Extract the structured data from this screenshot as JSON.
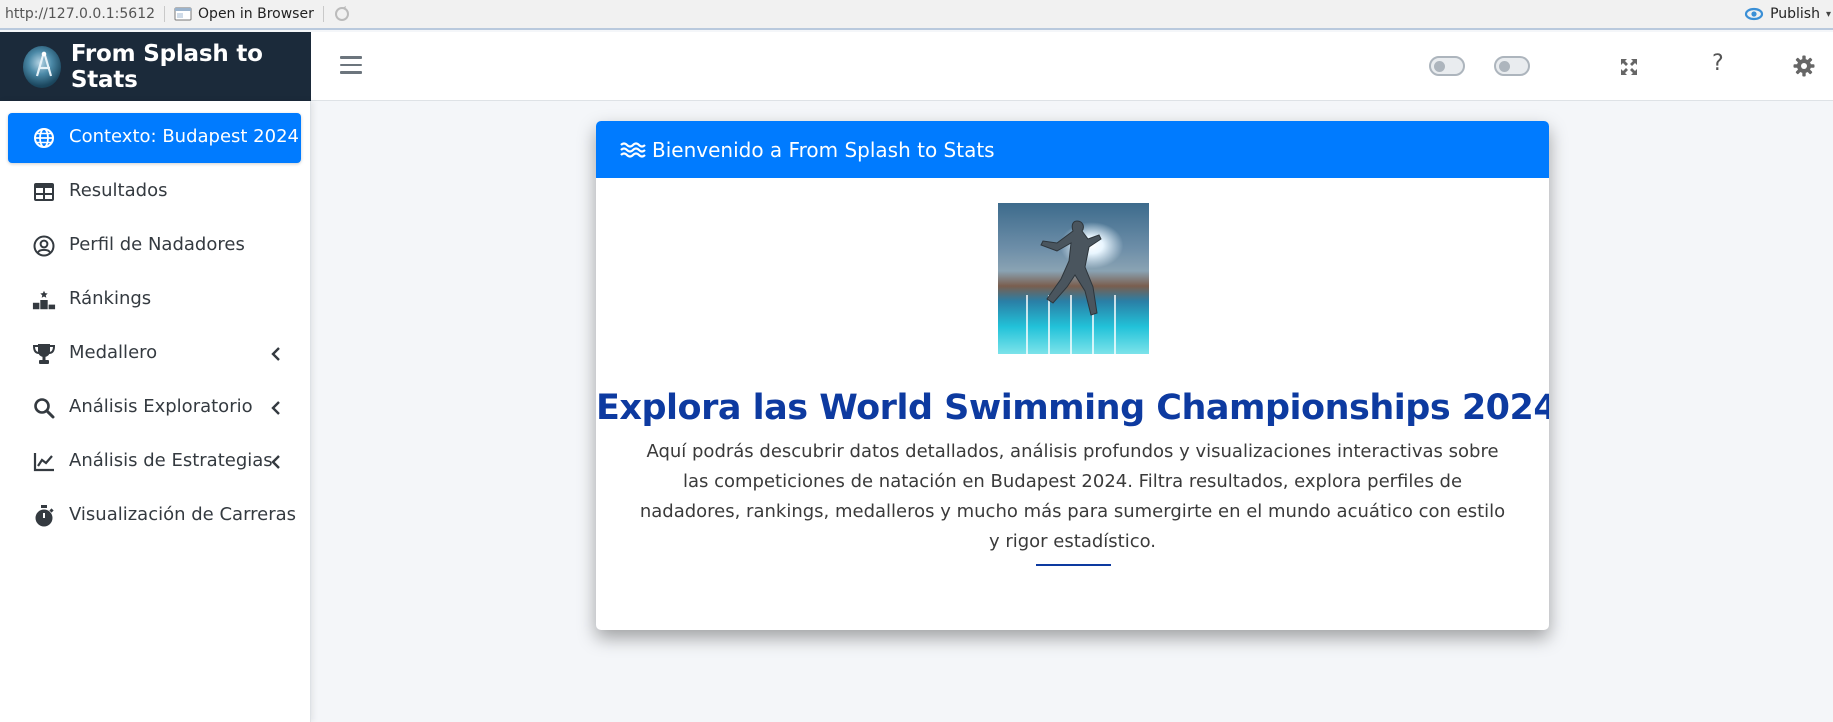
{
  "viewer": {
    "url": "http://127.0.0.1:5612",
    "open_in_browser": "Open in Browser",
    "publish": "Publish"
  },
  "brand": {
    "title": "From Splash to Stats",
    "logo_icon": "swimmer-logo"
  },
  "sidebar": {
    "items": [
      {
        "label": "Contexto: Budapest 2024",
        "icon": "globe-icon",
        "active": true,
        "has_submenu": false
      },
      {
        "label": "Resultados",
        "icon": "table-icon",
        "active": false,
        "has_submenu": false
      },
      {
        "label": "Perfil de Nadadores",
        "icon": "user-circle-icon",
        "active": false,
        "has_submenu": false
      },
      {
        "label": "Ránkings",
        "icon": "podium-icon",
        "active": false,
        "has_submenu": false
      },
      {
        "label": "Medallero",
        "icon": "trophy-icon",
        "active": false,
        "has_submenu": true
      },
      {
        "label": "Análisis Exploratorio",
        "icon": "search-icon",
        "active": false,
        "has_submenu": true
      },
      {
        "label": "Análisis de Estrategias",
        "icon": "line-chart-icon",
        "active": false,
        "has_submenu": true
      },
      {
        "label": "Visualización de Carreras",
        "icon": "stopwatch-icon",
        "active": false,
        "has_submenu": false
      }
    ]
  },
  "topbar": {
    "help_label": "?",
    "toggle_1_on": false,
    "toggle_2_on": false
  },
  "card": {
    "header": "Bienvenido a From Splash to Stats",
    "title": "Explora las World Swimming Championships 2024",
    "body": "Aquí podrás descubrir datos detallados, análisis profundos y visualizaciones interactivas sobre las competiciones de natación en Budapest 2024. Filtra resultados, explora perfiles de nadadores, rankings, medalleros y mucho más para sumergirte en el mundo acuático con estilo y rigor estadístico."
  },
  "colors": {
    "primary": "#007bff",
    "brand_bg": "#1b2a3a",
    "title_blue": "#0d3aa0",
    "page_bg": "#f4f6f9"
  }
}
